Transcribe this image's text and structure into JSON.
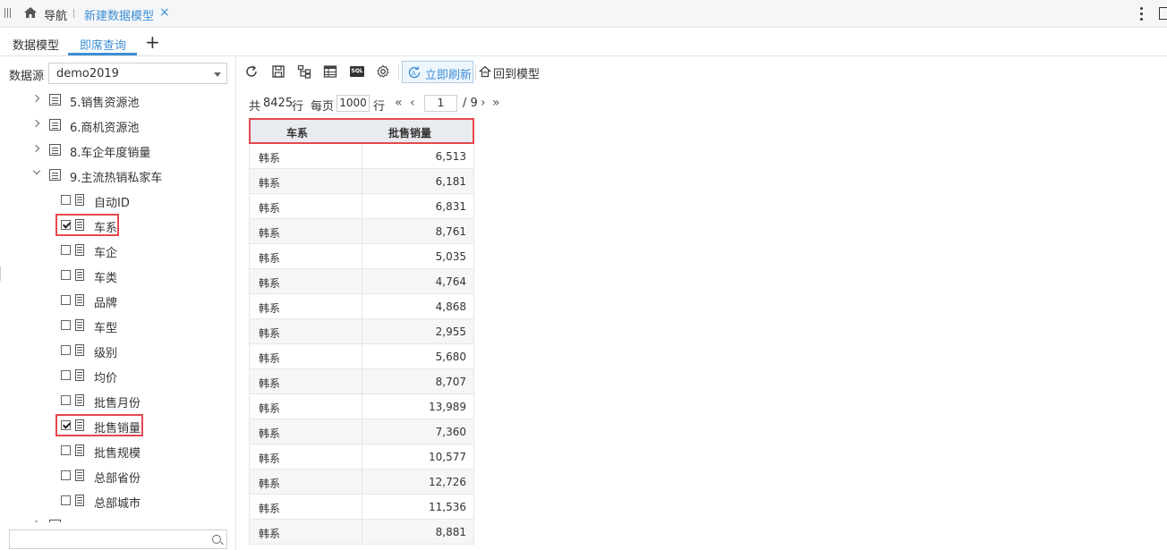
{
  "nav": {
    "label": "导航",
    "tab_title": "新建数据模型",
    "tab_close": "×"
  },
  "tabs": [
    {
      "label": "数据模型",
      "active": false
    },
    {
      "label": "即席查询",
      "active": true
    }
  ],
  "add_tab": "+",
  "datasource": {
    "label": "数据源",
    "value": "demo2019"
  },
  "tree": {
    "tables": [
      {
        "label": "5.销售资源池",
        "expanded": false
      },
      {
        "label": "6.商机资源池",
        "expanded": false
      },
      {
        "label": "8.车企年度销量",
        "expanded": false
      },
      {
        "label": "9.主流热销私家车",
        "expanded": true
      }
    ],
    "fields": [
      {
        "label": "自动ID",
        "checked": false
      },
      {
        "label": "车系",
        "checked": true
      },
      {
        "label": "车企",
        "checked": false
      },
      {
        "label": "车类",
        "checked": false
      },
      {
        "label": "品牌",
        "checked": false
      },
      {
        "label": "车型",
        "checked": false
      },
      {
        "label": "级别",
        "checked": false
      },
      {
        "label": "均价",
        "checked": false
      },
      {
        "label": "批售月份",
        "checked": false
      },
      {
        "label": "批售销量",
        "checked": true
      },
      {
        "label": "批售规模",
        "checked": false
      },
      {
        "label": "总部省份",
        "checked": false
      },
      {
        "label": "总部城市",
        "checked": false
      }
    ]
  },
  "toolbar": {
    "icons": [
      "refresh-icon",
      "save-icon",
      "hierarchy-icon",
      "table-view-icon",
      "sql-icon",
      "settings-icon"
    ],
    "sql_text": "SQL",
    "instant_refresh_label": "立即刷新",
    "back_to_model_label": "回到模型"
  },
  "pager": {
    "total_prefix": "共",
    "total_rows": "8425",
    "row_unit": "行",
    "per_page_label": "每页",
    "page_size": "1000",
    "page_size_unit": "行",
    "current_page": "1",
    "total_pages": "/ 9"
  },
  "grid": {
    "columns": [
      "车系",
      "批售销量"
    ],
    "rows": [
      [
        "韩系",
        "6,513"
      ],
      [
        "韩系",
        "6,181"
      ],
      [
        "韩系",
        "6,831"
      ],
      [
        "韩系",
        "8,761"
      ],
      [
        "韩系",
        "5,035"
      ],
      [
        "韩系",
        "4,764"
      ],
      [
        "韩系",
        "4,868"
      ],
      [
        "韩系",
        "2,955"
      ],
      [
        "韩系",
        "5,680"
      ],
      [
        "韩系",
        "8,707"
      ],
      [
        "韩系",
        "13,989"
      ],
      [
        "韩系",
        "7,360"
      ],
      [
        "韩系",
        "10,577"
      ],
      [
        "韩系",
        "12,726"
      ],
      [
        "韩系",
        "11,536"
      ],
      [
        "韩系",
        "8,881"
      ]
    ]
  },
  "colors": {
    "accent": "#3d8fd6",
    "highlight": "#e5484d"
  }
}
